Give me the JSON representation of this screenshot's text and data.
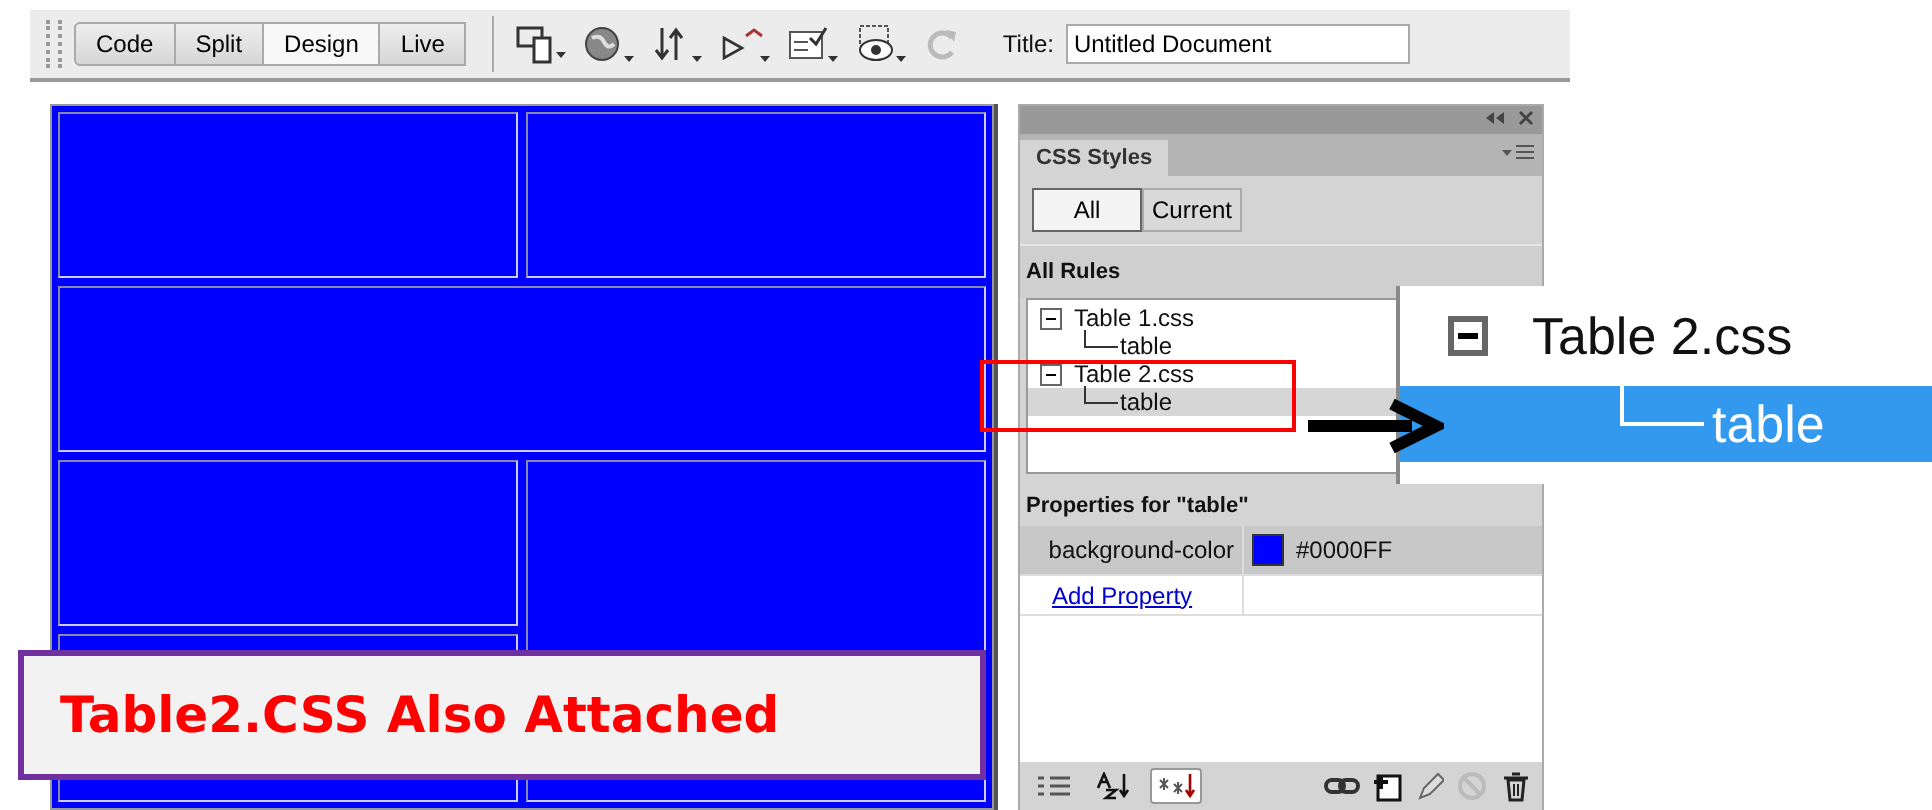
{
  "toolbar": {
    "view_buttons": [
      {
        "label": "Code",
        "selected": false
      },
      {
        "label": "Split",
        "selected": false
      },
      {
        "label": "Design",
        "selected": true
      },
      {
        "label": "Live",
        "selected": false
      }
    ],
    "title_label": "Title:",
    "title_value": "Untitled Document"
  },
  "css_panel": {
    "tab": "CSS Styles",
    "mode_buttons": [
      {
        "label": "All",
        "selected": true
      },
      {
        "label": "Current",
        "selected": false
      }
    ],
    "rules_heading": "All Rules",
    "rules": [
      {
        "label": "Table 1.css",
        "expanded": true,
        "children": [
          {
            "label": "table",
            "selected": false
          }
        ]
      },
      {
        "label": "Table 2.css",
        "expanded": true,
        "children": [
          {
            "label": "table",
            "selected": true
          }
        ]
      }
    ],
    "properties_heading": "Properties for \"table\"",
    "properties": [
      {
        "name": "background-color",
        "value": "#0000FF",
        "color": "#0000ff"
      }
    ],
    "add_property": "Add Property",
    "bottom_toggles": [
      {
        "kind": "category",
        "selected": false
      },
      {
        "kind": "alpha",
        "selected": false
      },
      {
        "kind": "set",
        "selected": true
      }
    ]
  },
  "callout": {
    "file": "Table 2.css",
    "rule": "table"
  },
  "annotation": "Table2.CSS Also Attached"
}
